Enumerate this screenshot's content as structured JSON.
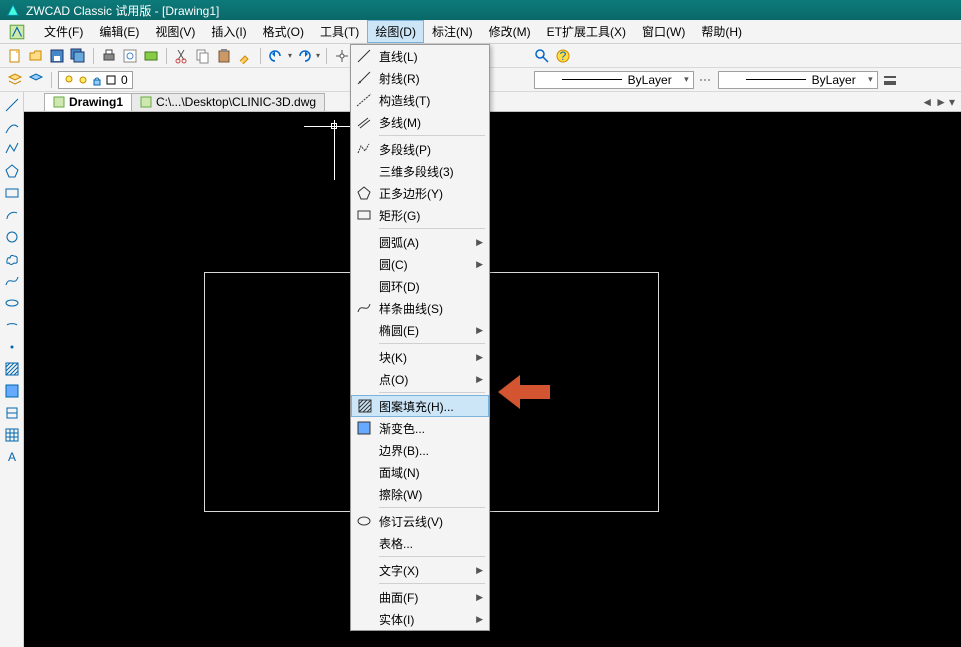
{
  "title": "ZWCAD Classic 试用版 - [Drawing1]",
  "menu": [
    "文件(F)",
    "编辑(E)",
    "视图(V)",
    "插入(I)",
    "格式(O)",
    "工具(T)",
    "绘图(D)",
    "标注(N)",
    "修改(M)",
    "ET扩展工具(X)",
    "窗口(W)",
    "帮助(H)"
  ],
  "menuOpenIndex": 6,
  "layer": {
    "current": "0",
    "bylayer1": "ByLayer",
    "bylayer2": "ByLayer"
  },
  "tabs": [
    {
      "label": "Drawing1",
      "active": true
    },
    {
      "label": "C:\\...\\Desktop\\CLINIC-3D.dwg",
      "active": false
    }
  ],
  "toolbar1Icons": [
    "new",
    "open",
    "save",
    "saveall",
    "print",
    "preview",
    "plot",
    "cut",
    "copy",
    "paste",
    "matchprop",
    "undo",
    "redo",
    "pan",
    "zoom",
    "tool",
    "grip"
  ],
  "leftIcons": [
    "line",
    "arc-line",
    "polyline",
    "polygon",
    "rect",
    "arc",
    "circle",
    "revcloud",
    "spline",
    "ellipse",
    "ellipse-arc",
    "dot",
    "hatch-pat",
    "gradient",
    "region",
    "table",
    "text"
  ],
  "dropdown": [
    {
      "label": "直线(L)",
      "icon": "line"
    },
    {
      "label": "射线(R)",
      "icon": "ray"
    },
    {
      "label": "构造线(T)",
      "icon": "xline"
    },
    {
      "label": "多线(M)",
      "icon": "mline"
    },
    {
      "sep": true
    },
    {
      "label": "多段线(P)",
      "icon": "pline"
    },
    {
      "label": "三维多段线(3)",
      "icon": ""
    },
    {
      "label": "正多边形(Y)",
      "icon": "polygon"
    },
    {
      "label": "矩形(G)",
      "icon": "rect"
    },
    {
      "sep": true
    },
    {
      "label": "圆弧(A)",
      "icon": "",
      "sub": true
    },
    {
      "label": "圆(C)",
      "icon": "",
      "sub": true
    },
    {
      "label": "圆环(D)",
      "icon": ""
    },
    {
      "label": "样条曲线(S)",
      "icon": "spline"
    },
    {
      "label": "椭圆(E)",
      "icon": "",
      "sub": true
    },
    {
      "sep": true
    },
    {
      "label": "块(K)",
      "icon": "",
      "sub": true
    },
    {
      "label": "点(O)",
      "icon": "",
      "sub": true
    },
    {
      "sep": true
    },
    {
      "label": "图案填充(H)...",
      "icon": "hatch",
      "hover": true
    },
    {
      "label": "渐变色...",
      "icon": "gradient"
    },
    {
      "label": "边界(B)...",
      "icon": ""
    },
    {
      "label": "面域(N)",
      "icon": ""
    },
    {
      "label": "擦除(W)",
      "icon": ""
    },
    {
      "sep": true
    },
    {
      "label": "修订云线(V)",
      "icon": "revcloud"
    },
    {
      "label": "表格...",
      "icon": ""
    },
    {
      "sep": true
    },
    {
      "label": "文字(X)",
      "icon": "",
      "sub": true
    },
    {
      "sep": true
    },
    {
      "label": "曲面(F)",
      "icon": "",
      "sub": true
    },
    {
      "label": "实体(I)",
      "icon": "",
      "sub": true
    }
  ]
}
